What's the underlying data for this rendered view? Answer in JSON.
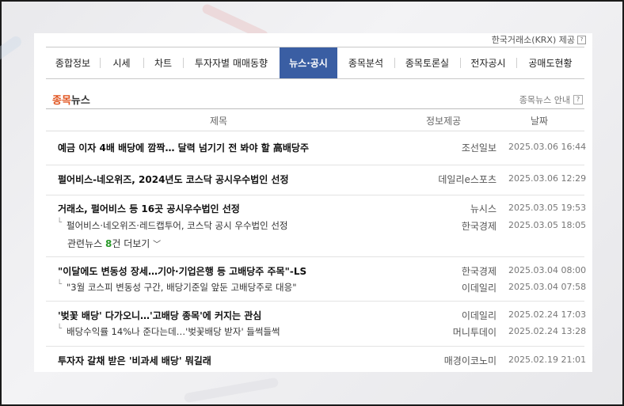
{
  "header": {
    "krx_label": "한국거래소(KRX) 제공",
    "help_icon": "?"
  },
  "tabs": [
    {
      "label": "종합정보",
      "active": false
    },
    {
      "label": "시세",
      "active": false
    },
    {
      "label": "차트",
      "active": false
    },
    {
      "label": "투자자별 매매동향",
      "active": false
    },
    {
      "label": "뉴스·공시",
      "active": true
    },
    {
      "label": "종목분석",
      "active": false
    },
    {
      "label": "종목토론실",
      "active": false
    },
    {
      "label": "전자공시",
      "active": false
    },
    {
      "label": "공매도현황",
      "active": false
    }
  ],
  "section": {
    "title_highlight": "종목",
    "title_rest": "뉴스",
    "guide": "종목뉴스 안내"
  },
  "columns": {
    "title": "제목",
    "source": "정보제공",
    "date": "날짜"
  },
  "news": [
    {
      "title": "예금 이자 4배 배당에 깜짝… 달력 넘기기 전 봐야 할 高배당주",
      "source": "조선일보",
      "date": "2025.03.06 16:44",
      "subs": []
    },
    {
      "title": "펄어비스-네오위즈, 2024년도 코스닥 공시우수법인 선정",
      "source": "데일리e스포츠",
      "date": "2025.03.06 12:29",
      "subs": []
    },
    {
      "title": "거래소, 펄어비스 등 16곳 공시우수법인 선정",
      "source": "뉴시스",
      "date": "2025.03.05 19:53",
      "subs": [
        {
          "title": "펄어비스·네오위즈·레드캡투어, 코스닥 공시 우수법인 선정",
          "source": "한국경제",
          "date": "2025.03.05 18:05"
        }
      ],
      "related": {
        "prefix": "관련뉴스 ",
        "count": "8",
        "suffix": "건 더보기"
      }
    },
    {
      "title": "\"이달에도 변동성 장세…기아·기업은행 등 고배당주 주목\"-LS",
      "source": "한국경제",
      "date": "2025.03.04 08:00",
      "subs": [
        {
          "title": "\"3월 코스피 변동성 구간, 배당기준일 앞둔 고배당주로 대응\"",
          "source": "이데일리",
          "date": "2025.03.04 07:58"
        }
      ]
    },
    {
      "title": "'벚꽃 배당' 다가오니…'고배당 종목'에 커지는 관심",
      "source": "이데일리",
      "date": "2025.02.24 17:03",
      "subs": [
        {
          "title": "배당수익률 14%나 준다는데…'벚꽃배당 받자' 들썩들썩",
          "source": "머니투데이",
          "date": "2025.02.24 13:28"
        }
      ]
    },
    {
      "title": "투자자 갈채 받은 '비과세 배당' 뭐길래",
      "source": "매경이코노미",
      "date": "2025.02.19 21:01",
      "subs": []
    }
  ]
}
